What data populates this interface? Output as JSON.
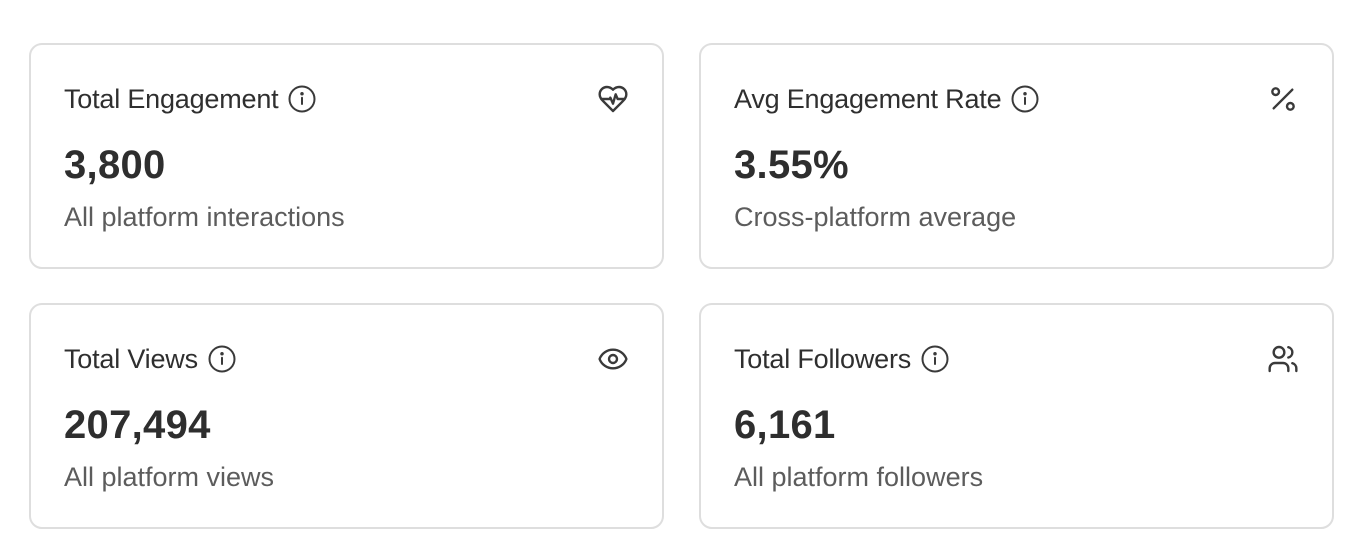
{
  "cards": [
    {
      "title": "Total Engagement",
      "value": "3,800",
      "subtitle": "All platform interactions",
      "icon": "heart-pulse-icon"
    },
    {
      "title": "Avg Engagement Rate",
      "value": "3.55%",
      "subtitle": "Cross-platform average",
      "icon": "percent-icon"
    },
    {
      "title": "Total Views",
      "value": "207,494",
      "subtitle": "All platform views",
      "icon": "eye-icon"
    },
    {
      "title": "Total Followers",
      "value": "6,161",
      "subtitle": "All platform followers",
      "icon": "users-icon"
    }
  ],
  "colors": {
    "card_border": "#dedede",
    "title_text": "#2f2f2f",
    "value_text": "#2e2e2e",
    "subtitle_text": "#5c5c5c",
    "icon_stroke": "#3a3a3a"
  }
}
